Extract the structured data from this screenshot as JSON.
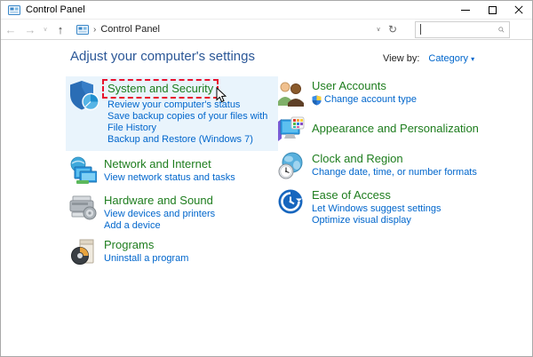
{
  "window": {
    "title": "Control Panel"
  },
  "navbar": {
    "back_glyph": "←",
    "forward_glyph": "→",
    "recent_glyph": "∨",
    "up_glyph": "↑",
    "breadcrumb_chevron": "›",
    "breadcrumb": "Control Panel",
    "address_dropdown_glyph": "∨",
    "refresh_glyph": "↻"
  },
  "search": {
    "value": "",
    "placeholder": ""
  },
  "header": {
    "title": "Adjust your computer's settings",
    "view_by_label": "View by:",
    "view_by_value": "Category",
    "view_by_caret": "▾"
  },
  "categories": {
    "left": [
      {
        "title": "System and Security",
        "links": [
          "Review your computer's status",
          "Save backup copies of your files with File History",
          "Backup and Restore (Windows 7)"
        ]
      },
      {
        "title": "Network and Internet",
        "links": [
          "View network status and tasks"
        ]
      },
      {
        "title": "Hardware and Sound",
        "links": [
          "View devices and printers",
          "Add a device"
        ]
      },
      {
        "title": "Programs",
        "links": [
          "Uninstall a program"
        ]
      }
    ],
    "right": [
      {
        "title": "User Accounts",
        "links": [
          "Change account type"
        ]
      },
      {
        "title": "Appearance and Personalization",
        "links": []
      },
      {
        "title": "Clock and Region",
        "links": [
          "Change date, time, or number formats"
        ]
      },
      {
        "title": "Ease of Access",
        "links": [
          "Let Windows suggest settings",
          "Optimize visual display"
        ]
      }
    ]
  },
  "icons": {
    "control-panel-icon": "blue panel glyph",
    "minimize-icon": "thin dash",
    "maximize-icon": "hollow square",
    "close-icon": "x cross",
    "search-icon": "magnifier",
    "system-security-icon": "blue shield with pie chart",
    "network-icon": "globe with monitors",
    "hardware-icon": "printer",
    "programs-icon": "software box with cd",
    "user-accounts-icon": "two people",
    "appearance-icon": "monitor with palette",
    "clock-region-icon": "globe with clock",
    "ease-of-access-icon": "blue circle clock arrow",
    "uac-shield-icon": "four-color shield",
    "mouse-cursor": "pointer arrow",
    "annotation-box": "red dashed rectangle"
  },
  "colors": {
    "category_title": "#1e7d1e",
    "task_link": "#0066cc",
    "page_heading": "#2b5797",
    "hover_highlight": "#e9f4fc",
    "annotation_red": "#e8112d",
    "window_border": "#a8a8a8"
  }
}
